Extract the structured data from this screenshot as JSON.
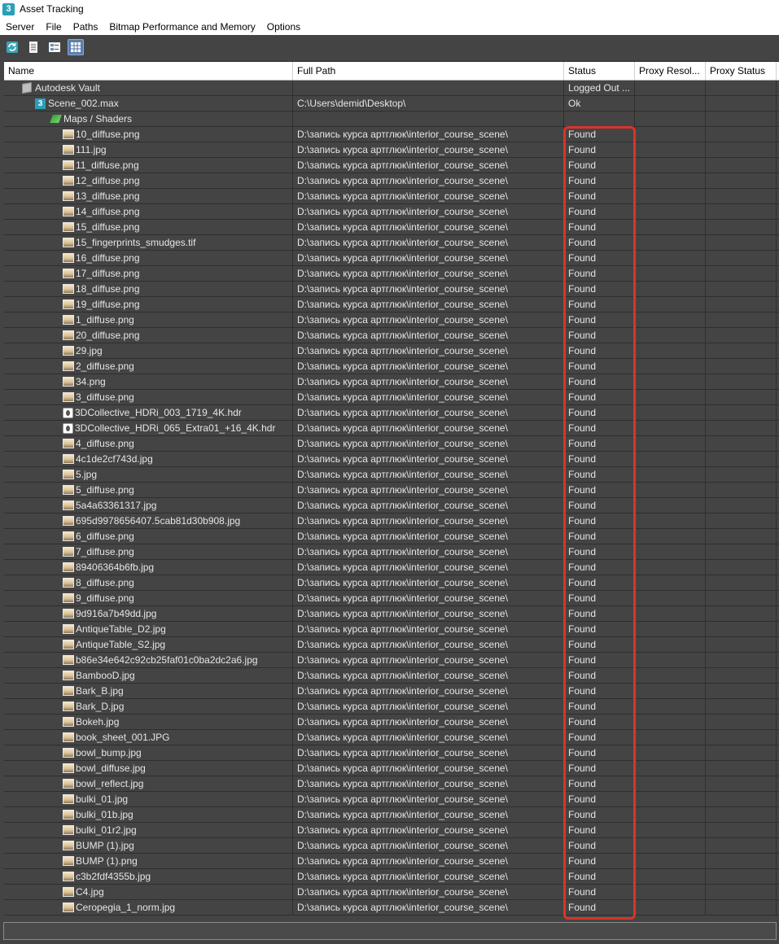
{
  "window": {
    "title": "Asset Tracking",
    "logo_glyph": "3"
  },
  "menu": [
    "Server",
    "File",
    "Paths",
    "Bitmap Performance and Memory",
    "Options"
  ],
  "toolbar": {
    "buttons": [
      {
        "icon": "refresh-icon"
      },
      {
        "icon": "list-view-icon"
      },
      {
        "icon": "detail-view-icon"
      },
      {
        "icon": "table-view-icon",
        "active": true
      }
    ]
  },
  "table": {
    "columns": [
      "Name",
      "Full Path",
      "Status",
      "Proxy Resol...",
      "Proxy Status"
    ],
    "tree": [
      {
        "name": "Autodesk Vault",
        "path": "",
        "status": "Logged Out ...",
        "icon": "vault-icon"
      },
      {
        "name": "Scene_002.max",
        "path": "C:\\Users\\demid\\Desktop\\",
        "status": "Ok",
        "icon": "scene-icon"
      },
      {
        "name": "Maps / Shaders",
        "path": "",
        "status": "",
        "icon": "maps-icon"
      }
    ],
    "files_path": "D:\\запись курса артглюк\\interior_course_scene\\",
    "files_status": "Found",
    "files": [
      "10_diffuse.png",
      "111.jpg",
      "11_diffuse.png",
      "12_diffuse.png",
      "13_diffuse.png",
      "14_diffuse.png",
      "15_diffuse.png",
      "15_fingerprints_smudges.tif",
      "16_diffuse.png",
      "17_diffuse.png",
      "18_diffuse.png",
      "19_diffuse.png",
      "1_diffuse.png",
      "20_diffuse.png",
      "29.jpg",
      "2_diffuse.png",
      "34.png",
      "3_diffuse.png",
      "3DCollective_HDRi_003_1719_4K.hdr",
      "3DCollective_HDRi_065_Extra01_+16_4K.hdr",
      "4_diffuse.png",
      "4c1de2cf743d.jpg",
      "5.jpg",
      "5_diffuse.png",
      "5a4a63361317.jpg",
      "695d9978656407.5cab81d30b908.jpg",
      "6_diffuse.png",
      "7_diffuse.png",
      "89406364b6fb.jpg",
      "8_diffuse.png",
      "9_diffuse.png",
      "9d916a7b49dd.jpg",
      "AntiqueTable_D2.jpg",
      "AntiqueTable_S2.jpg",
      "b86e34e642c92cb25faf01c0ba2dc2a6.jpg",
      "BambooD.jpg",
      "Bark_B.jpg",
      "Bark_D.jpg",
      "Bokeh.jpg",
      "book_sheet_001.JPG",
      "bowl_bump.jpg",
      "bowl_diffuse.jpg",
      "bowl_reflect.jpg",
      "bulki_01.jpg",
      "bulki_01b.jpg",
      "bulki_01r2.jpg",
      "BUMP (1).jpg",
      "BUMP (1).png",
      "c3b2fdf4355b.jpg",
      "C4.jpg",
      "Ceropegia_1_norm.jpg"
    ]
  },
  "colors": {
    "background": "#444444",
    "highlight": "#d9342b",
    "accent": "#5b7fae"
  }
}
